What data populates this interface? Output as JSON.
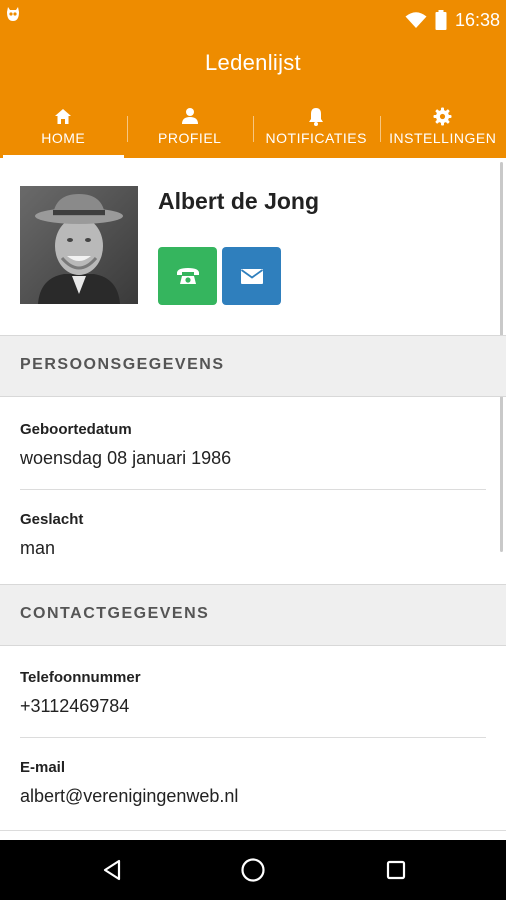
{
  "status_bar": {
    "time": "16:38",
    "icons": [
      "owl-icon",
      "wifi-icon",
      "battery-icon"
    ]
  },
  "app": {
    "title": "Ledenlijst",
    "accent_color": "#ee8c00"
  },
  "tabs": [
    {
      "label": "HOME",
      "icon": "home-icon",
      "active": true
    },
    {
      "label": "PROFIEL",
      "icon": "person-icon",
      "active": false
    },
    {
      "label": "NOTIFICATIES",
      "icon": "bell-icon",
      "active": false
    },
    {
      "label": "INSTELLINGEN",
      "icon": "gear-icon",
      "active": false
    }
  ],
  "profile": {
    "name": "Albert de Jong",
    "call_color": "#35b55e",
    "mail_color": "#2f7fbd"
  },
  "sections": [
    {
      "title": "PERSOONSGEGEVENS",
      "fields": [
        {
          "label": "Geboortedatum",
          "value": "woensdag 08 januari 1986"
        },
        {
          "label": "Geslacht",
          "value": "man"
        }
      ]
    },
    {
      "title": "CONTACTGEGEVENS",
      "fields": [
        {
          "label": "Telefoonnummer",
          "value": "+3112469784"
        },
        {
          "label": "E-mail",
          "value": "albert@verenigingenweb.nl"
        }
      ]
    }
  ],
  "nav": [
    "back-icon",
    "home-circle-icon",
    "recents-icon"
  ]
}
